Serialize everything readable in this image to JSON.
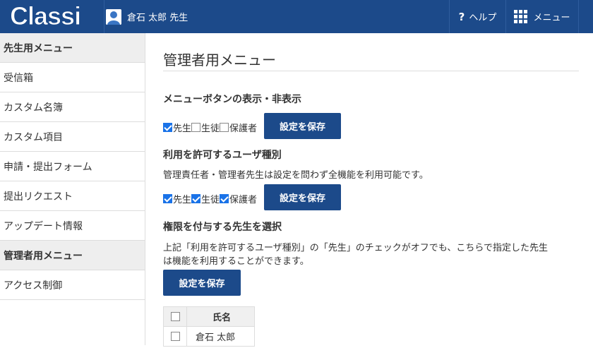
{
  "header": {
    "logo_text": "Classi",
    "user_name": "倉石 太郎 先生",
    "help_label": "ヘルプ",
    "menu_label": "メニュー"
  },
  "sidebar": {
    "items": [
      {
        "label": "先生用メニュー",
        "section": true
      },
      {
        "label": "受信箱"
      },
      {
        "label": "カスタム名簿"
      },
      {
        "label": "カスタム項目"
      },
      {
        "label": "申請・提出フォーム"
      },
      {
        "label": "提出リクエスト"
      },
      {
        "label": "アップデート情報"
      },
      {
        "label": "管理者用メニュー",
        "section": true
      },
      {
        "label": "アクセス制御"
      }
    ]
  },
  "main": {
    "title": "管理者用メニュー",
    "section1": {
      "heading": "メニューボタンの表示・非表示",
      "checks": [
        {
          "label": "先生",
          "checked": true
        },
        {
          "label": "生徒",
          "checked": false
        },
        {
          "label": "保護者",
          "checked": false
        }
      ],
      "save_label": "設定を保存"
    },
    "section2": {
      "heading": "利用を許可するユーザ種別",
      "description": "管理責任者・管理者先生は設定を問わず全機能を利用可能です。",
      "checks": [
        {
          "label": "先生",
          "checked": true
        },
        {
          "label": "生徒",
          "checked": true
        },
        {
          "label": "保護者",
          "checked": true
        }
      ],
      "save_label": "設定を保存"
    },
    "section3": {
      "heading": "権限を付与する先生を選択",
      "description_line1": "上記「利用を許可するユーザ種別」の「先生」のチェックがオフでも、こちらで指定した先生",
      "description_line2": "は機能を利用することができます。",
      "save_label": "設定を保存",
      "table": {
        "header": "氏名",
        "rows": [
          "倉石 太郎"
        ]
      }
    }
  },
  "colors": {
    "header_bg": "#1c4a8a",
    "button_bg": "#1c4a8a",
    "check_on": "#1a73e8",
    "section_bg": "#eeeeee"
  }
}
